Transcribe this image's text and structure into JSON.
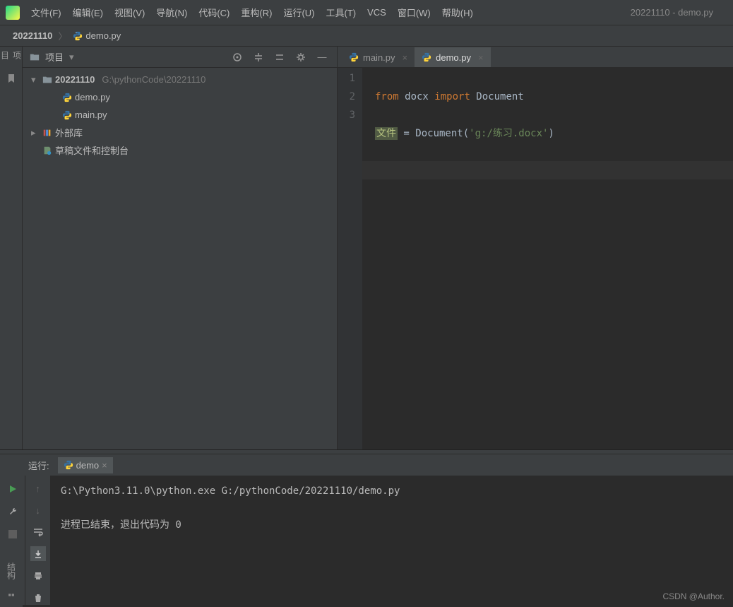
{
  "window_title": "20221110 - demo.py",
  "menu": [
    "文件(F)",
    "编辑(E)",
    "视图(V)",
    "导航(N)",
    "代码(C)",
    "重构(R)",
    "运行(U)",
    "工具(T)",
    "VCS",
    "窗口(W)",
    "帮助(H)"
  ],
  "breadcrumb": {
    "project": "20221110",
    "file": "demo.py"
  },
  "project_panel": {
    "title": "项目",
    "root": {
      "name": "20221110",
      "path": "G:\\pythonCode\\20221110"
    },
    "files": [
      "demo.py",
      "main.py"
    ],
    "external_lib": "外部库",
    "scratches": "草稿文件和控制台"
  },
  "tabs": [
    {
      "label": "main.py",
      "active": false
    },
    {
      "label": "demo.py",
      "active": true
    }
  ],
  "editor": {
    "gutter": [
      "1",
      "2",
      "3"
    ],
    "code": {
      "l1_from": "from",
      "l1_docx": " docx ",
      "l1_import": "import",
      "l1_doc": " Document",
      "l2_var": "文件",
      "l2_mid": " = Document(",
      "l2_str": "'g:/练习.docx'",
      "l2_end": ")"
    }
  },
  "run_panel": {
    "label": "运行:",
    "tab": "demo",
    "line1": "G:\\Python3.11.0\\python.exe G:/pythonCode/20221110/demo.py",
    "line2": "进程已结束，退出代码为 0"
  },
  "left_gutter_label": "项目",
  "left_bottom_label": "结构",
  "watermark": "CSDN @Author."
}
